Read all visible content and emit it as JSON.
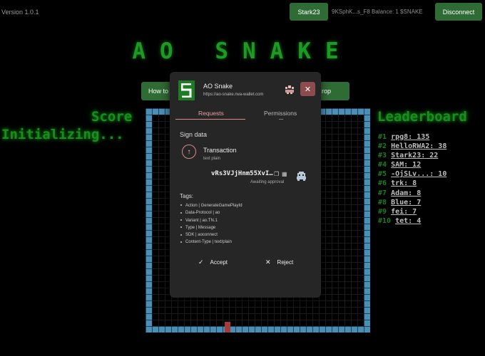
{
  "header": {
    "version": "Version 1.0.1",
    "user_button": "Stark23",
    "wallet_info": "9KSphK...s_F8  Balance: 1 $SNAKE",
    "disconnect_button": "Disconnect"
  },
  "game": {
    "title": "AO SNAKE",
    "how_to_button": "How to",
    "drop_button": "rop",
    "score_label": "Score",
    "status_text": "Initializing...",
    "leaderboard_title": "Leaderboard"
  },
  "leaderboard": [
    {
      "rank": "#1",
      "entry": "rpg8: 135"
    },
    {
      "rank": "#2",
      "entry": "HelloRWA2: 38"
    },
    {
      "rank": "#3",
      "entry": "Stark23: 22"
    },
    {
      "rank": "#4",
      "entry": "SAM: 12"
    },
    {
      "rank": "#5",
      "entry": "-OjSLv...: 10"
    },
    {
      "rank": "#6",
      "entry": "trk: 8"
    },
    {
      "rank": "#7",
      "entry": "Adam: 8"
    },
    {
      "rank": "#8",
      "entry": "Blue: 7"
    },
    {
      "rank": "#9",
      "entry": "fei: 7"
    },
    {
      "rank": "#10",
      "entry": "tet: 4"
    }
  ],
  "modal": {
    "app_name": "AO Snake",
    "app_url": "https://ao-snake.rwa-wallet.com",
    "tabs": [
      "Requests",
      "Permissions"
    ],
    "section_title": "Sign data",
    "transaction": {
      "label": "Transaction",
      "subtitle": "text plain",
      "id": "vRs3VJjHnm55XvI…",
      "status": "Awaiting approval"
    },
    "tags_title": "Tags:",
    "tags": [
      "Action | GenerateGamePlayId",
      "Data-Protocol | ao",
      "Variant | ao.TN.1",
      "Type | Message",
      "SDK | aoconnect",
      "Content-Type | text/plain"
    ],
    "accept_label": "Accept",
    "reject_label": "Reject"
  },
  "icons": {
    "app_logo": "ao-snake-logo",
    "wallet": "wallet-icon",
    "close": "close-icon",
    "transaction": "arrow-up-icon",
    "copy": "copy-icon",
    "qr": "qr-icon",
    "accept": "check-icon",
    "reject": "x-icon"
  },
  "colors": {
    "accent_green": "#1c9a24",
    "button_green": "#2f6b34",
    "board_border": "#4a8fb8",
    "snake": "#a93a3a",
    "modal_accent": "#d88a8a"
  }
}
